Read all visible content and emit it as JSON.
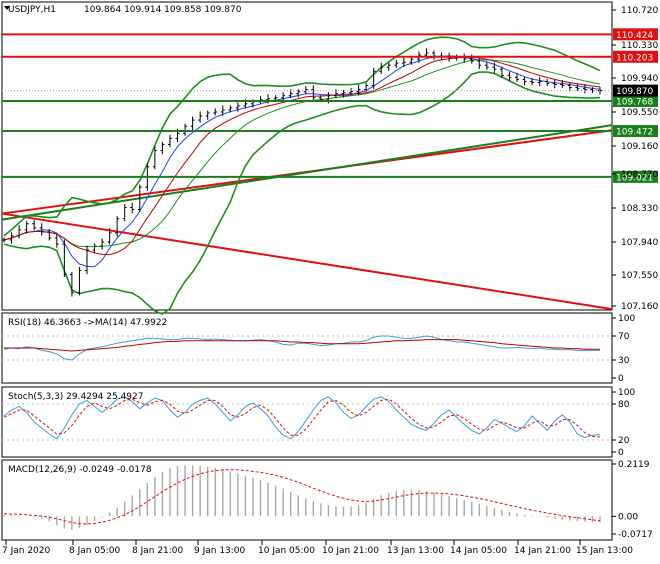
{
  "colors": {
    "green_line": "#1a7f1a",
    "red_line": "#e01010",
    "bb_band": "#1d8f1d",
    "ma_blue": "#2040ff",
    "ma_red": "#c00000",
    "price": "#000000",
    "rsi_line": "#3aa0d0",
    "rsi_ma": "#c00000",
    "stoch_main": "#3aa0d0",
    "stoch_signal": "#e01010",
    "macd_hist": "#a8a8a8",
    "macd_signal": "#e01010"
  },
  "chart_data": [
    {
      "type": "line",
      "title": "USDJPY,H1",
      "header_values": "109.864 109.914 109.858 109.870",
      "ylim": [
        107.711,
        110.742
      ],
      "ytick_labels": [
        "110.720",
        "110.330",
        "109.940",
        "109.550",
        "109.160",
        "108.770",
        "108.330",
        "107.940",
        "107.550",
        "107.160"
      ],
      "price_badge": "109.870",
      "levels": [
        {
          "label": "110.424",
          "value": 110.424,
          "color": "red"
        },
        {
          "label": "110.203",
          "value": 110.203,
          "color": "red"
        },
        {
          "label": "109.768",
          "value": 109.768,
          "color": "green"
        },
        {
          "label": "109.472",
          "value": 109.472,
          "color": "green"
        },
        {
          "label": "109.021",
          "value": 109.021,
          "color": "green"
        }
      ],
      "x_labels": [
        "7 Jan 2020",
        "8 Jan 05:00",
        "8 Jan 21:00",
        "9 Jan 13:00",
        "10 Jan 05:00",
        "10 Jan 21:00",
        "13 Jan 13:00",
        "14 Jan 05:00",
        "14 Jan 21:00",
        "15 Jan 13:00"
      ],
      "trend_lines": [
        {
          "color": "red",
          "from": [
            0,
            108.66
          ],
          "to": [
            100,
            107.72
          ]
        },
        {
          "color": "red",
          "from": [
            0,
            108.66
          ],
          "to": [
            100,
            109.48
          ]
        },
        {
          "color": "green",
          "from": [
            0,
            108.6
          ],
          "to": [
            100,
            109.53
          ]
        }
      ],
      "close": [
        108.4,
        108.44,
        108.5,
        108.56,
        108.52,
        108.48,
        108.42,
        108.36,
        108.06,
        107.88,
        108.1,
        108.3,
        108.34,
        108.38,
        108.47,
        108.61,
        108.72,
        108.7,
        108.92,
        109.12,
        109.28,
        109.34,
        109.4,
        109.45,
        109.52,
        109.58,
        109.62,
        109.65,
        109.66,
        109.68,
        109.7,
        109.72,
        109.74,
        109.76,
        109.78,
        109.79,
        109.8,
        109.82,
        109.84,
        109.86,
        109.88,
        109.8,
        109.78,
        109.82,
        109.84,
        109.85,
        109.86,
        109.88,
        109.92,
        110.06,
        110.1,
        110.12,
        110.14,
        110.15,
        110.18,
        110.22,
        110.24,
        110.21,
        110.2,
        110.19,
        110.2,
        110.18,
        110.16,
        110.12,
        110.1,
        110.08,
        110.02,
        110.0,
        109.98,
        109.96,
        109.95,
        109.96,
        109.94,
        109.93,
        109.92,
        109.9,
        109.89,
        109.88,
        109.87,
        109.87
      ]
    },
    {
      "type": "line",
      "title": "RSI(18) 46.3663 ->MA(14) 47.9922",
      "ylim": [
        0,
        100
      ],
      "ytick_labels": [
        "100",
        "70",
        "30",
        "0"
      ],
      "levels": [
        70,
        30
      ],
      "series": [
        {
          "name": "RSI(18)",
          "values": [
            48,
            50,
            49,
            52,
            50,
            46,
            44,
            40,
            32,
            30,
            40,
            48,
            50,
            52,
            55,
            58,
            60,
            62,
            64,
            66,
            66,
            65,
            64,
            64,
            66,
            66,
            65,
            64,
            65,
            64,
            63,
            62,
            62,
            63,
            64,
            62,
            60,
            56,
            55,
            58,
            58,
            56,
            54,
            55,
            57,
            58,
            60,
            60,
            62,
            68,
            70,
            70,
            68,
            66,
            66,
            68,
            70,
            68,
            64,
            62,
            60,
            60,
            58,
            56,
            54,
            52,
            50,
            50,
            51,
            50,
            49,
            50,
            48,
            48,
            47,
            47,
            46,
            46,
            46,
            46
          ]
        },
        {
          "name": "MA(14)",
          "values": [
            50,
            50,
            50,
            50,
            50,
            49,
            48,
            47,
            46,
            45,
            46,
            47,
            48,
            49,
            50,
            51,
            53,
            54,
            56,
            57,
            59,
            60,
            61,
            61,
            62,
            62,
            62,
            62,
            62,
            62,
            62,
            62,
            62,
            62,
            62,
            62,
            62,
            61,
            60,
            60,
            59,
            59,
            58,
            57,
            57,
            57,
            57,
            57,
            58,
            59,
            60,
            61,
            62,
            62,
            63,
            63,
            64,
            64,
            64,
            64,
            64,
            63,
            62,
            61,
            60,
            59,
            57,
            56,
            55,
            54,
            53,
            52,
            51,
            50,
            50,
            49,
            49,
            48,
            48,
            48
          ]
        }
      ]
    },
    {
      "type": "line",
      "title": "Stoch(5,3,3) 29.4294 25.4927",
      "ylim": [
        0,
        100
      ],
      "ytick_labels": [
        "100",
        "80",
        "20",
        "0"
      ],
      "levels": [
        80,
        20
      ],
      "series": [
        {
          "name": "%K",
          "values": [
            60,
            70,
            76,
            66,
            50,
            40,
            30,
            22,
            40,
            62,
            80,
            86,
            76,
            66,
            76,
            88,
            92,
            84,
            72,
            82,
            90,
            86,
            70,
            58,
            66,
            80,
            86,
            90,
            80,
            66,
            52,
            62,
            76,
            82,
            72,
            60,
            42,
            28,
            22,
            34,
            52,
            70,
            86,
            92,
            82,
            66,
            56,
            62,
            76,
            88,
            92,
            84,
            70,
            58,
            46,
            40,
            36,
            48,
            62,
            70,
            58,
            46,
            36,
            30,
            40,
            54,
            48,
            40,
            34,
            44,
            60,
            48,
            36,
            52,
            62,
            50,
            30,
            24,
            28,
            29
          ]
        },
        {
          "name": "%D",
          "values": [
            58,
            64,
            70,
            70,
            60,
            50,
            40,
            30,
            32,
            44,
            62,
            76,
            82,
            76,
            72,
            78,
            86,
            88,
            82,
            78,
            84,
            86,
            80,
            68,
            64,
            70,
            78,
            86,
            86,
            76,
            62,
            58,
            64,
            74,
            78,
            70,
            56,
            40,
            28,
            28,
            38,
            54,
            70,
            84,
            86,
            78,
            66,
            60,
            66,
            76,
            86,
            88,
            80,
            68,
            56,
            46,
            40,
            42,
            50,
            60,
            62,
            56,
            46,
            38,
            36,
            44,
            50,
            46,
            40,
            40,
            48,
            52,
            44,
            44,
            54,
            54,
            44,
            32,
            26,
            25
          ]
        }
      ]
    },
    {
      "type": "bar",
      "title": "MACD(12,26,9) -0.0249 -0.0178",
      "ylim": [
        -0.0717,
        0.2119
      ],
      "ytick_labels": [
        "0.2119",
        "0.00",
        "-0.0717"
      ],
      "series": [
        {
          "name": "MACD",
          "values": [
            0.005,
            0.004,
            0.002,
            0.0,
            -0.004,
            -0.01,
            -0.02,
            -0.035,
            -0.05,
            -0.055,
            -0.048,
            -0.035,
            -0.02,
            -0.005,
            0.015,
            0.035,
            0.06,
            0.085,
            0.11,
            0.135,
            0.16,
            0.18,
            0.195,
            0.203,
            0.206,
            0.207,
            0.205,
            0.201,
            0.196,
            0.19,
            0.182,
            0.174,
            0.165,
            0.156,
            0.146,
            0.136,
            0.125,
            0.112,
            0.098,
            0.085,
            0.072,
            0.062,
            0.052,
            0.045,
            0.04,
            0.038,
            0.04,
            0.045,
            0.055,
            0.07,
            0.085,
            0.095,
            0.102,
            0.106,
            0.108,
            0.106,
            0.102,
            0.096,
            0.09,
            0.082,
            0.074,
            0.066,
            0.058,
            0.05,
            0.042,
            0.034,
            0.026,
            0.019,
            0.012,
            0.006,
            0.002,
            -0.002,
            -0.006,
            -0.01,
            -0.014,
            -0.017,
            -0.02,
            -0.022,
            -0.024,
            -0.025
          ]
        },
        {
          "name": "Signal",
          "values": [
            0.01,
            0.009,
            0.008,
            0.006,
            0.004,
            0.001,
            -0.004,
            -0.01,
            -0.018,
            -0.025,
            -0.03,
            -0.031,
            -0.029,
            -0.024,
            -0.016,
            -0.006,
            0.006,
            0.022,
            0.04,
            0.06,
            0.08,
            0.1,
            0.118,
            0.135,
            0.15,
            0.162,
            0.172,
            0.18,
            0.185,
            0.188,
            0.189,
            0.188,
            0.186,
            0.182,
            0.178,
            0.172,
            0.166,
            0.158,
            0.148,
            0.138,
            0.126,
            0.114,
            0.102,
            0.091,
            0.081,
            0.073,
            0.066,
            0.062,
            0.06,
            0.062,
            0.066,
            0.072,
            0.078,
            0.084,
            0.089,
            0.092,
            0.094,
            0.094,
            0.093,
            0.091,
            0.087,
            0.083,
            0.078,
            0.072,
            0.066,
            0.059,
            0.052,
            0.045,
            0.038,
            0.031,
            0.025,
            0.019,
            0.013,
            0.008,
            0.003,
            -0.002,
            -0.006,
            -0.01,
            -0.014,
            -0.018
          ]
        }
      ]
    }
  ]
}
